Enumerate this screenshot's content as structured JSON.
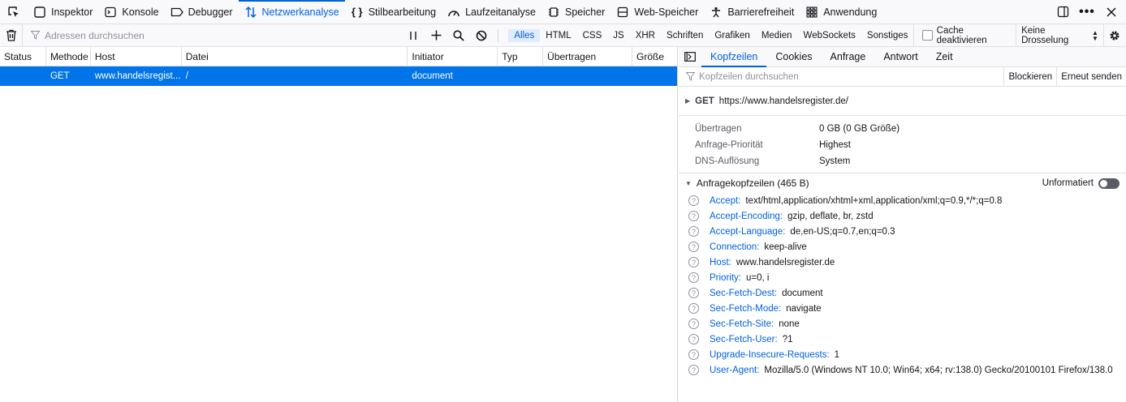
{
  "toolbox": {
    "tabs": [
      {
        "label": "Inspektor",
        "icon": "inspector-icon"
      },
      {
        "label": "Konsole",
        "icon": "console-icon"
      },
      {
        "label": "Debugger",
        "icon": "debugger-icon"
      },
      {
        "label": "Netzwerkanalyse",
        "icon": "network-icon",
        "active": true
      },
      {
        "label": "Stilbearbeitung",
        "icon": "style-editor-icon"
      },
      {
        "label": "Laufzeitanalyse",
        "icon": "performance-icon"
      },
      {
        "label": "Speicher",
        "icon": "memory-icon"
      },
      {
        "label": "Web-Speicher",
        "icon": "storage-icon"
      },
      {
        "label": "Barrierefreiheit",
        "icon": "accessibility-icon"
      },
      {
        "label": "Anwendung",
        "icon": "application-icon"
      }
    ]
  },
  "nettool": {
    "filter_placeholder": "Adressen durchsuchen",
    "types": [
      "Alles",
      "HTML",
      "CSS",
      "JS",
      "XHR",
      "Schriften",
      "Grafiken",
      "Medien",
      "WebSockets",
      "Sonstiges"
    ],
    "active_type": "Alles",
    "cache_label": "Cache deaktivieren",
    "throttle_label": "Keine Drosselung"
  },
  "table": {
    "columns": [
      "Status",
      "Methode",
      "Host",
      "Datei",
      "Initiator",
      "Typ",
      "Übertragen",
      "Größe"
    ],
    "rows": [
      {
        "status": "",
        "method": "GET",
        "host": "www.handelsregist...",
        "file": "/",
        "initiator": "document",
        "type": "",
        "transferred": "",
        "size": ""
      }
    ]
  },
  "details": {
    "tabs": [
      "Kopfzeilen",
      "Cookies",
      "Anfrage",
      "Antwort",
      "Zeit"
    ],
    "active_tab": "Kopfzeilen",
    "filter_placeholder": "Kopfzeilen durchsuchen",
    "block_label": "Blockieren",
    "resend_label": "Erneut senden",
    "request_method": "GET",
    "request_url": "https://www.handelsregister.de/",
    "summary": [
      {
        "key": "Übertragen",
        "value": "0 GB (0 GB Größe)"
      },
      {
        "key": "Anfrage-Priorität",
        "value": "Highest"
      },
      {
        "key": "DNS-Auflösung",
        "value": "System"
      }
    ],
    "section_title": "Anfragekopfzeilen (465 B)",
    "raw_label": "Unformatiert",
    "headers": [
      {
        "name": "Accept:",
        "value": "text/html,application/xhtml+xml,application/xml;q=0.9,*/*;q=0.8"
      },
      {
        "name": "Accept-Encoding:",
        "value": "gzip, deflate, br, zstd"
      },
      {
        "name": "Accept-Language:",
        "value": "de,en-US;q=0.7,en;q=0.3"
      },
      {
        "name": "Connection:",
        "value": "keep-alive"
      },
      {
        "name": "Host:",
        "value": "www.handelsregister.de"
      },
      {
        "name": "Priority:",
        "value": "u=0, i"
      },
      {
        "name": "Sec-Fetch-Dest:",
        "value": "document"
      },
      {
        "name": "Sec-Fetch-Mode:",
        "value": "navigate"
      },
      {
        "name": "Sec-Fetch-Site:",
        "value": "none"
      },
      {
        "name": "Sec-Fetch-User:",
        "value": "?1"
      },
      {
        "name": "Upgrade-Insecure-Requests:",
        "value": "1"
      },
      {
        "name": "User-Agent:",
        "value": "Mozilla/5.0 (Windows NT 10.0; Win64; x64; rv:138.0) Gecko/20100101 Firefox/138.0"
      }
    ]
  },
  "colors": {
    "accent": "#0061e0",
    "selected_row": "#0074e8"
  }
}
